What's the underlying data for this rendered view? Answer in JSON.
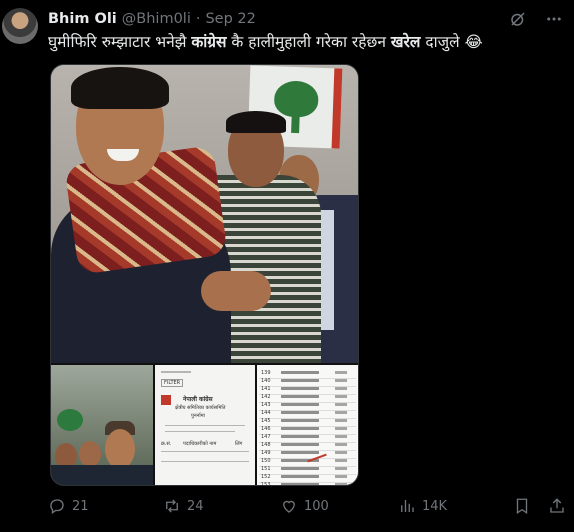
{
  "author": {
    "display_name": "Bhim Oli",
    "handle": "@Bhim0li",
    "separator": "·",
    "date": "Sep 22"
  },
  "tweet": {
    "text_part1": "घुमीफिरि रुम्झाटार भनेझै ",
    "text_bold1": "कांग्रेस",
    "text_part2": " कै हालीमुहाली गरेका रहेछन ",
    "text_bold2": "खरेल",
    "text_part3": " दाजुले ",
    "emoji": "😂"
  },
  "media": {
    "doc_mid": {
      "button": "FILTER",
      "title1": "नेपाली कांग्रेस",
      "title2": "क्षेत्रीय समितिका कार्यसमिति",
      "title3": "पुनर्नामा",
      "table_header1": "क्र.सं.",
      "table_header2": "पदाधिकारीको नाम",
      "table_header3": "लिंग"
    },
    "doc_right": {
      "row_numbers": [
        "139",
        "140",
        "141",
        "142",
        "143",
        "144",
        "145",
        "146",
        "147",
        "148",
        "149",
        "150",
        "151",
        "152",
        "153"
      ]
    }
  },
  "actions": {
    "reply_count": "21",
    "retweet_count": "24",
    "like_count": "100",
    "view_count": "14K"
  },
  "colors": {
    "background": "#000000",
    "text": "#e7e9ea",
    "muted": "#71767b",
    "border": "#2f3336"
  },
  "icons": [
    "grok-icon",
    "more-icon",
    "reply-icon",
    "retweet-icon",
    "like-icon",
    "views-icon",
    "bookmark-icon",
    "share-icon"
  ]
}
